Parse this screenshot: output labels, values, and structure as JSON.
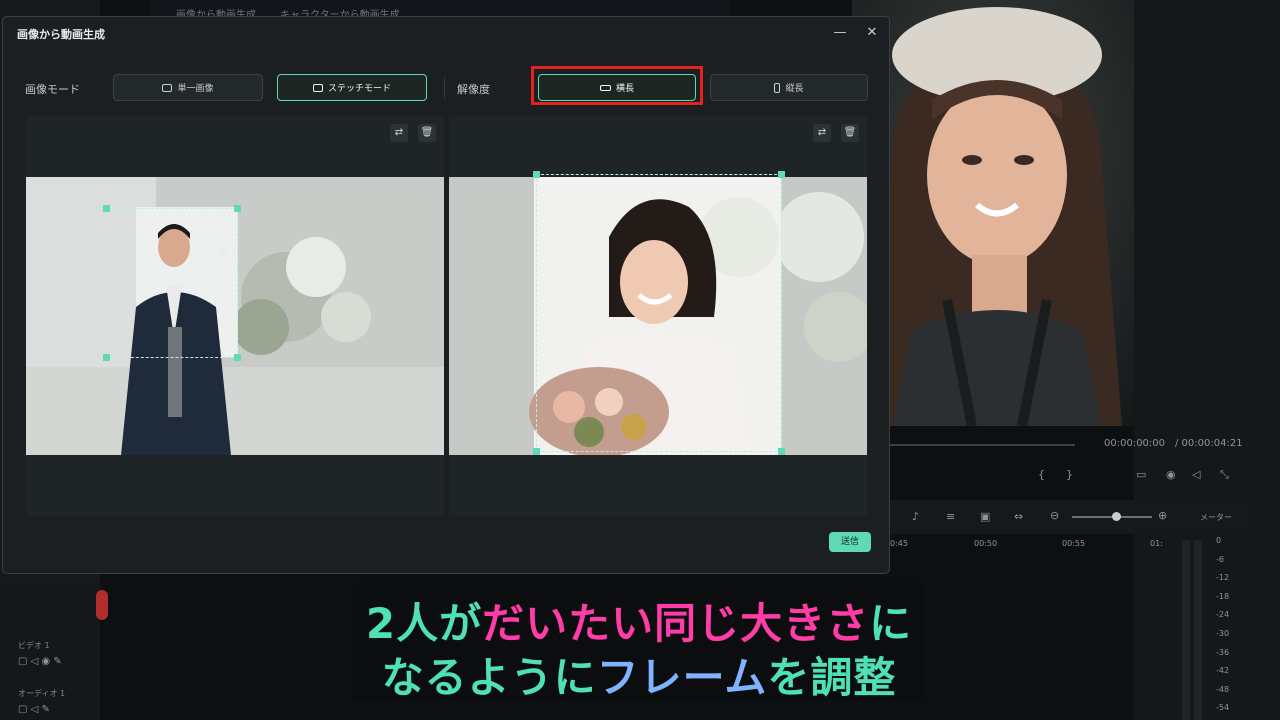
{
  "background_app": {
    "tabs": [
      "画像から動画生成",
      "キャラクターから動画生成"
    ],
    "timecode_current": "00:00:00:00",
    "timecode_total": "/ 00:00:04:21",
    "ruler_ticks": [
      "0:45",
      "00:50",
      "00:55",
      "01:"
    ],
    "meter_label": "メーター",
    "meter_ticks": [
      "0",
      "-6",
      "-12",
      "-18",
      "-24",
      "-30",
      "-36",
      "-42",
      "-48",
      "-54"
    ],
    "track_video": "ビデオ 1",
    "track_audio": "オーディオ 1"
  },
  "dialog": {
    "title": "画像から動画生成",
    "image_mode_label": "画像モード",
    "mode_options": [
      {
        "label": "単一画像",
        "icon": "image-icon",
        "selected": false
      },
      {
        "label": "ステッチモード",
        "icon": "person-image-icon",
        "selected": true
      }
    ],
    "resolution_label": "解像度",
    "resolution_options": [
      {
        "label": "横長",
        "icon": "landscape-icon",
        "selected": true
      },
      {
        "label": "縦長",
        "icon": "portrait-icon",
        "selected": false
      }
    ],
    "send_label": "送信",
    "colors": {
      "accent": "#5fd9b6",
      "highlight": "#e61f1f"
    }
  },
  "subtitle": {
    "line1": [
      {
        "text": "2人が",
        "color": "teal"
      },
      {
        "text": "だいたい",
        "color": "pink"
      },
      {
        "text": "同じ",
        "color": "pink"
      },
      {
        "text": "大きさ",
        "color": "pink"
      },
      {
        "text": "に",
        "color": "teal"
      }
    ],
    "line2": [
      {
        "text": "なるように",
        "color": "teal"
      },
      {
        "text": "フレーム",
        "color": "blue"
      },
      {
        "text": "を調整",
        "color": "teal"
      }
    ],
    "colors": {
      "teal": "#4fe0b4",
      "pink": "#ff3ca8",
      "blue": "#7fb2ff"
    }
  }
}
